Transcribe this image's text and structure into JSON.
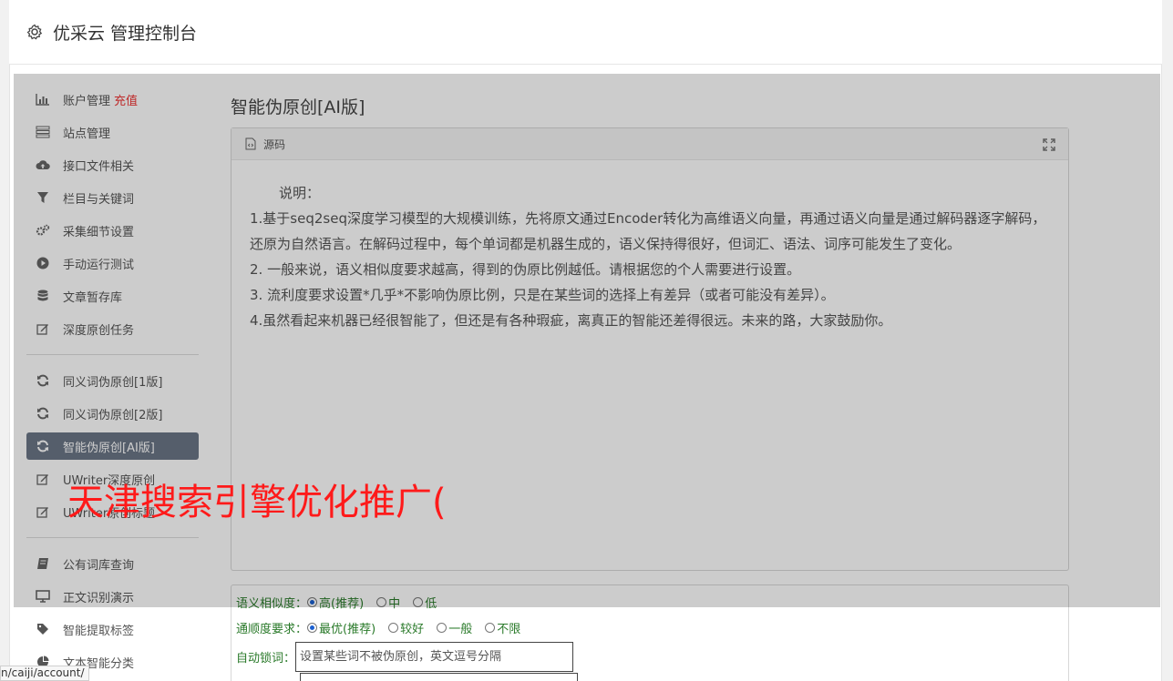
{
  "header": {
    "title": "优采云 管理控制台",
    "icon": "gear-icon"
  },
  "sidebar": {
    "items": [
      {
        "label": "账户管理",
        "badge": "充值",
        "icon": "bar-chart-icon"
      },
      {
        "label": "站点管理",
        "icon": "server-icon"
      },
      {
        "label": "接口文件相关",
        "icon": "cloud-upload-icon"
      },
      {
        "label": "栏目与关键词",
        "icon": "filter-icon"
      },
      {
        "label": "采集细节设置",
        "icon": "cogs-icon"
      },
      {
        "label": "手动运行测试",
        "icon": "play-circle-icon"
      },
      {
        "label": "文章暂存库",
        "icon": "database-icon"
      },
      {
        "label": "深度原创任务",
        "icon": "edit-icon"
      },
      {
        "label": "同义词伪原创[1版]",
        "icon": "refresh-icon"
      },
      {
        "label": "同义词伪原创[2版]",
        "icon": "refresh-icon"
      },
      {
        "label": "智能伪原创[AI版]",
        "icon": "refresh-icon",
        "active": true
      },
      {
        "label": "UWriter深度原创",
        "icon": "edit-icon"
      },
      {
        "label": "UWriter原创标题",
        "icon": "edit-icon"
      },
      {
        "label": "公有词库查询",
        "icon": "book-icon"
      },
      {
        "label": "正文识别演示",
        "icon": "monitor-icon"
      },
      {
        "label": "智能提取标签",
        "icon": "tag-icon"
      },
      {
        "label": "文本智能分类",
        "icon": "pie-chart-icon"
      }
    ]
  },
  "main": {
    "title": "智能伪原创[AI版]",
    "panel": {
      "heading": "源码",
      "lead": "说明：",
      "paragraphs": [
        "1.基于seq2seq深度学习模型的大规模训练，先将原文通过Encoder转化为高维语义向量，再通过语义向量是通过解码器逐字解码，还原为自然语言。在解码过程中，每个单词都是机器生成的，语义保持得很好，但词汇、语法、词序可能发生了变化。",
        "2. 一般来说，语义相似度要求越高，得到的伪原比例越低。请根据您的个人需要进行设置。",
        "3. 流利度要求设置*几乎*不影响伪原比例，只是在某些词的选择上有差异（或者可能没有差异）。",
        "4.虽然看起来机器已经很智能了，但还是有各种瑕疵，离真正的智能还差得很远。未来的路，大家鼓励你。"
      ]
    },
    "form": {
      "similarity": {
        "label": "语义相似度：",
        "options": [
          "高(推荐)",
          "中",
          "低"
        ],
        "selected": "高(推荐)"
      },
      "fluency": {
        "label": "通顺度要求：",
        "options": [
          "最优(推荐)",
          "较好",
          "一般",
          "不限"
        ],
        "selected": "最优(推荐)"
      },
      "lock": {
        "label": "自动锁词：",
        "placeholder": "设置某些词不被伪原创，英文逗号分隔"
      }
    }
  },
  "watermark": "天津搜索引擎优化推广(",
  "status_url": "n/caiji/account/"
}
